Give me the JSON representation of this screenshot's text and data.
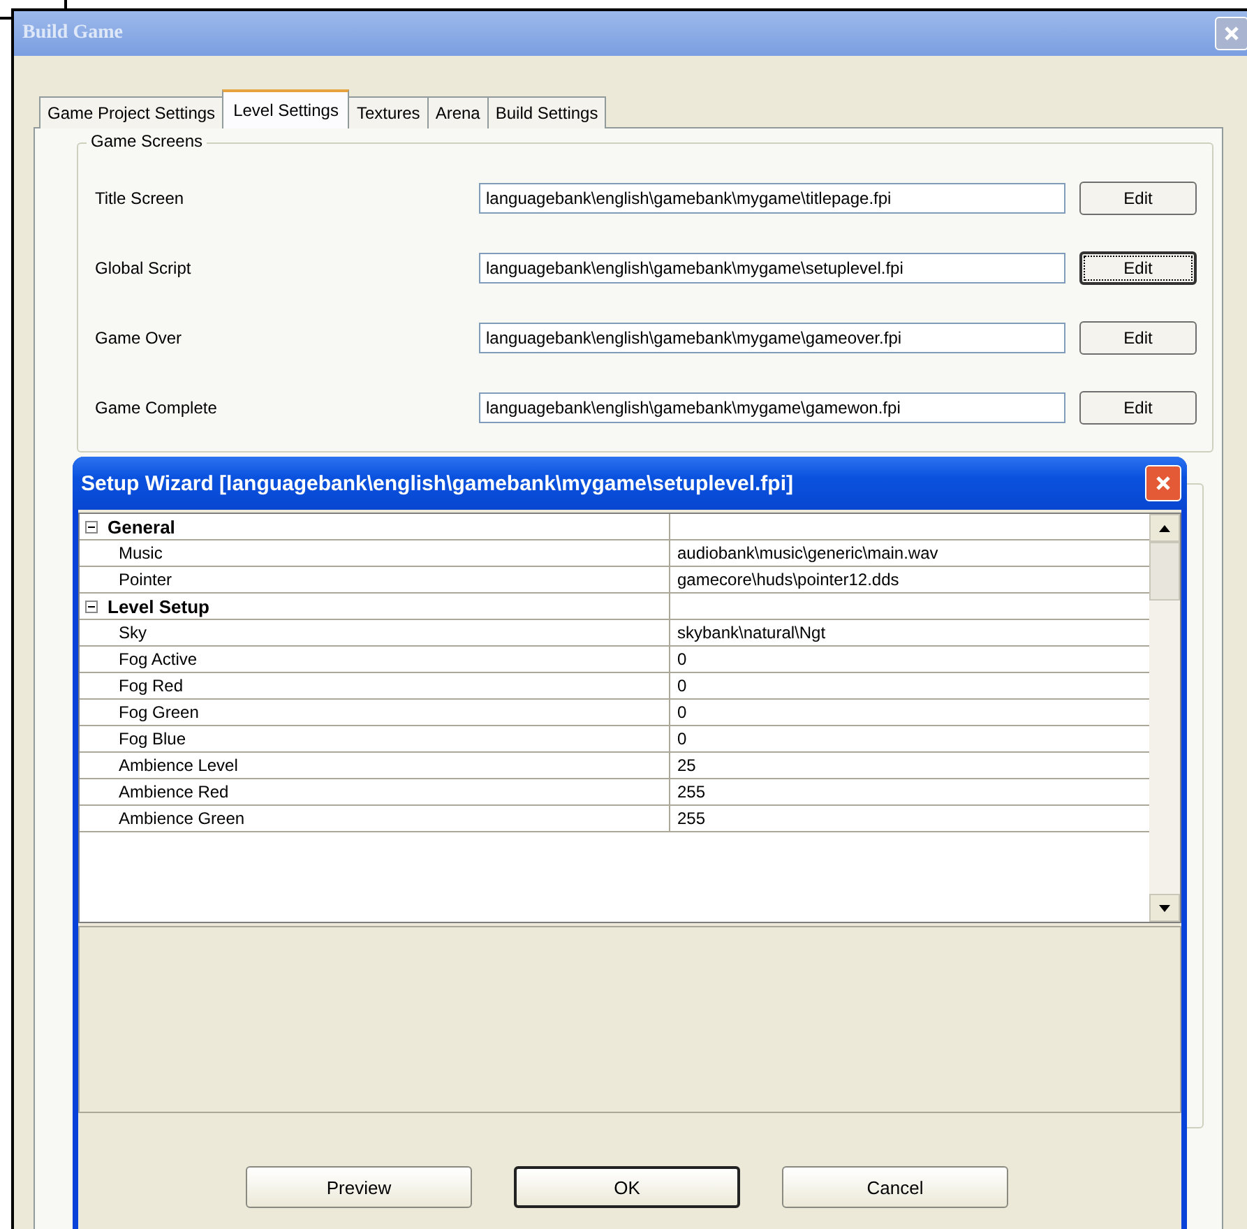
{
  "window": {
    "title": "Build Game"
  },
  "tabs": [
    {
      "label": "Game Project Settings",
      "selected": false
    },
    {
      "label": "Level Settings",
      "selected": true
    },
    {
      "label": "Textures",
      "selected": false
    },
    {
      "label": "Arena",
      "selected": false
    },
    {
      "label": "Build Settings",
      "selected": false
    }
  ],
  "game_screens": {
    "title": "Game Screens",
    "rows": [
      {
        "label": "Title Screen",
        "value": "languagebank\\english\\gamebank\\mygame\\titlepage.fpi",
        "button": "Edit",
        "focused": false
      },
      {
        "label": "Global Script",
        "value": "languagebank\\english\\gamebank\\mygame\\setuplevel.fpi",
        "button": "Edit",
        "focused": true
      },
      {
        "label": "Game Over",
        "value": "languagebank\\english\\gamebank\\mygame\\gameover.fpi",
        "button": "Edit",
        "focused": false
      },
      {
        "label": "Game Complete",
        "value": "languagebank\\english\\gamebank\\mygame\\gamewon.fpi",
        "button": "Edit",
        "focused": false
      }
    ]
  },
  "setup_wizard": {
    "title": "Setup Wizard [languagebank\\english\\gamebank\\mygame\\setuplevel.fpi]",
    "categories": [
      {
        "name": "General",
        "expanded": true,
        "properties": [
          {
            "name": "Music",
            "value": "audiobank\\music\\generic\\main.wav"
          },
          {
            "name": "Pointer",
            "value": "gamecore\\huds\\pointer12.dds"
          }
        ]
      },
      {
        "name": "Level Setup",
        "expanded": true,
        "properties": [
          {
            "name": "Sky",
            "value": "skybank\\natural\\Ngt"
          },
          {
            "name": "Fog Active",
            "value": "0"
          },
          {
            "name": "Fog Red",
            "value": "0"
          },
          {
            "name": "Fog Green",
            "value": "0"
          },
          {
            "name": "Fog Blue",
            "value": "0"
          },
          {
            "name": "Ambience Level",
            "value": "25"
          },
          {
            "name": "Ambience Red",
            "value": "255"
          },
          {
            "name": "Ambience Green",
            "value": "255"
          }
        ]
      }
    ],
    "buttons": [
      {
        "label": "Preview",
        "default": false
      },
      {
        "label": "OK",
        "default": true
      },
      {
        "label": "Cancel",
        "default": false
      }
    ]
  }
}
